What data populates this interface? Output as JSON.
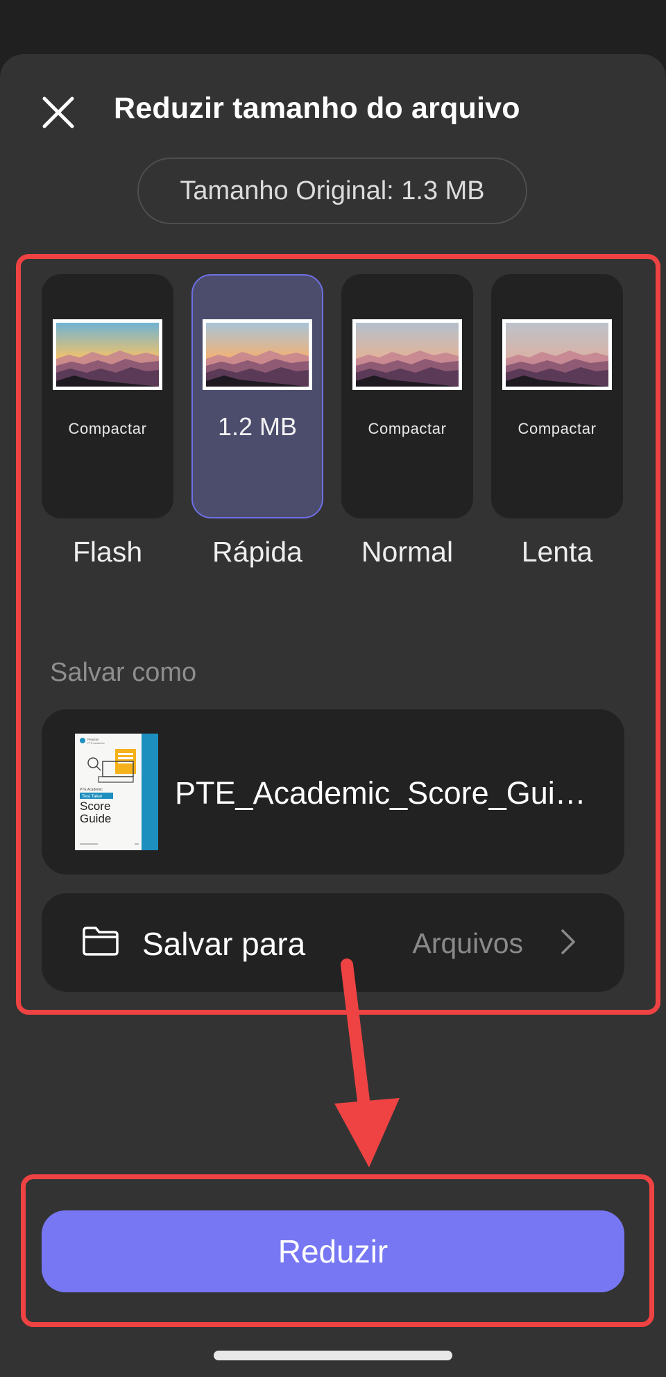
{
  "dialog": {
    "title": "Reduzir tamanho do arquivo",
    "original_size": "Tamanho Original: 1.3 MB"
  },
  "levels": [
    {
      "name": "Flash",
      "sub": "Compactar",
      "selected": false
    },
    {
      "name": "Rápida",
      "sub": "1.2 MB",
      "selected": true
    },
    {
      "name": "Normal",
      "sub": "Compactar",
      "selected": false
    },
    {
      "name": "Lenta",
      "sub": "Compactar",
      "selected": false
    }
  ],
  "save_as": {
    "label": "Salvar como",
    "file_name": "PTE_Academic_Score_Guide.pdf",
    "thumbnail": {
      "brand": "Pearson",
      "brand_line2": "PTE Academic",
      "line1": "PTE Academic",
      "badge": "Test Taker",
      "line2": "Score",
      "line3": "Guide"
    }
  },
  "save_to": {
    "label": "Salvar para",
    "value": "Arquivos"
  },
  "primary_button": "Reduzir",
  "colors": {
    "accent": "#7777F4",
    "selected_card": "#4C4C6D",
    "annotation": "#EF4343",
    "sheet_background": "#333333"
  },
  "icons": {
    "close": "close-icon",
    "folder": "folder-icon",
    "chevron": "chevron-right-icon"
  }
}
